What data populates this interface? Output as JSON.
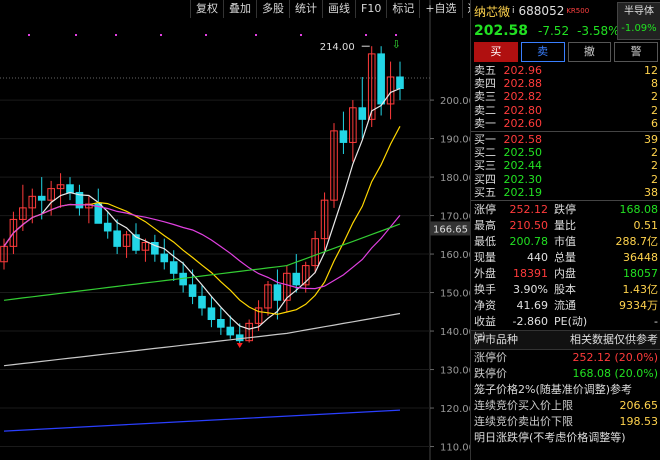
{
  "toolbar": [
    "复权",
    "叠加",
    "多股",
    "统计",
    "画线",
    "F10",
    "标记",
    "+自选",
    "返回"
  ],
  "chart_data": {
    "type": "candlestick",
    "y_ticks": [
      110,
      120,
      130,
      140,
      150,
      160,
      170,
      180,
      190,
      200
    ],
    "ylim": [
      106.5,
      226
    ],
    "current_price_label": "166.65",
    "high_annotation": "214.00",
    "low_marker_value": 136.9,
    "candles": [
      {
        "o": 158,
        "h": 164,
        "l": 156,
        "c": 162
      },
      {
        "o": 162,
        "h": 171,
        "l": 160,
        "c": 169
      },
      {
        "o": 169,
        "h": 178,
        "l": 166,
        "c": 172
      },
      {
        "o": 172,
        "h": 177,
        "l": 168,
        "c": 175
      },
      {
        "o": 175,
        "h": 180,
        "l": 169,
        "c": 174
      },
      {
        "o": 174,
        "h": 179,
        "l": 170,
        "c": 177
      },
      {
        "o": 177,
        "h": 181,
        "l": 172,
        "c": 178
      },
      {
        "o": 178,
        "h": 180,
        "l": 174,
        "c": 176
      },
      {
        "o": 176,
        "h": 178,
        "l": 170,
        "c": 172
      },
      {
        "o": 172,
        "h": 175,
        "l": 168,
        "c": 173
      },
      {
        "o": 173,
        "h": 177,
        "l": 169,
        "c": 168
      },
      {
        "o": 168,
        "h": 171,
        "l": 164,
        "c": 166
      },
      {
        "o": 166,
        "h": 169,
        "l": 160,
        "c": 162
      },
      {
        "o": 162,
        "h": 166,
        "l": 159,
        "c": 165
      },
      {
        "o": 165,
        "h": 168,
        "l": 160,
        "c": 161
      },
      {
        "o": 161,
        "h": 164,
        "l": 158,
        "c": 163
      },
      {
        "o": 163,
        "h": 165,
        "l": 158,
        "c": 160
      },
      {
        "o": 160,
        "h": 164,
        "l": 156,
        "c": 158
      },
      {
        "o": 158,
        "h": 161,
        "l": 153,
        "c": 155
      },
      {
        "o": 155,
        "h": 158,
        "l": 150,
        "c": 152
      },
      {
        "o": 152,
        "h": 156,
        "l": 147,
        "c": 149
      },
      {
        "o": 149,
        "h": 152,
        "l": 144,
        "c": 146
      },
      {
        "o": 146,
        "h": 149,
        "l": 141,
        "c": 143
      },
      {
        "o": 143,
        "h": 146,
        "l": 139,
        "c": 141
      },
      {
        "o": 141,
        "h": 144,
        "l": 138,
        "c": 139
      },
      {
        "o": 139,
        "h": 142,
        "l": 136.9,
        "c": 137.5
      },
      {
        "o": 137.5,
        "h": 143,
        "l": 137,
        "c": 142
      },
      {
        "o": 142,
        "h": 148,
        "l": 140,
        "c": 146
      },
      {
        "o": 146,
        "h": 153,
        "l": 144,
        "c": 152
      },
      {
        "o": 152,
        "h": 156,
        "l": 143,
        "c": 148
      },
      {
        "o": 148,
        "h": 157,
        "l": 145,
        "c": 155
      },
      {
        "o": 155,
        "h": 160,
        "l": 150,
        "c": 152
      },
      {
        "o": 152,
        "h": 158,
        "l": 150,
        "c": 157
      },
      {
        "o": 157,
        "h": 166,
        "l": 155,
        "c": 164
      },
      {
        "o": 164,
        "h": 176,
        "l": 161,
        "c": 174
      },
      {
        "o": 174,
        "h": 194,
        "l": 172,
        "c": 192
      },
      {
        "o": 192,
        "h": 197,
        "l": 186,
        "c": 189
      },
      {
        "o": 189,
        "h": 200,
        "l": 184,
        "c": 198
      },
      {
        "o": 198,
        "h": 206,
        "l": 190,
        "c": 195
      },
      {
        "o": 195,
        "h": 214,
        "l": 193,
        "c": 212
      },
      {
        "o": 212,
        "h": 214,
        "l": 196,
        "c": 199
      },
      {
        "o": 199,
        "h": 210,
        "l": 195,
        "c": 206
      },
      {
        "o": 206,
        "h": 210,
        "l": 200,
        "c": 203
      }
    ]
  },
  "panel": {
    "name": "纳芯微",
    "name_suffix": "i",
    "code": "688052",
    "tag": "KR500",
    "sector": "半导体",
    "sector_change": "-1.09%",
    "price": "202.58",
    "change": "-7.52",
    "change_pct": "-3.58%",
    "buttons": [
      "买",
      "卖",
      "撤",
      "警"
    ],
    "asks": [
      {
        "label": "卖五",
        "price": "202.96",
        "vol": "12"
      },
      {
        "label": "卖四",
        "price": "202.88",
        "vol": "8"
      },
      {
        "label": "卖三",
        "price": "202.82",
        "vol": "2"
      },
      {
        "label": "卖二",
        "price": "202.80",
        "vol": "2"
      },
      {
        "label": "卖一",
        "price": "202.60",
        "vol": "6"
      }
    ],
    "bids": [
      {
        "label": "买一",
        "price": "202.58",
        "vol": "39"
      },
      {
        "label": "买二",
        "price": "202.50",
        "vol": "2"
      },
      {
        "label": "买三",
        "price": "202.44",
        "vol": "2"
      },
      {
        "label": "买四",
        "price": "202.30",
        "vol": "2"
      },
      {
        "label": "买五",
        "price": "202.19",
        "vol": "38"
      }
    ],
    "stats": [
      {
        "k1": "涨停",
        "v1": "252.12",
        "c1": "red",
        "k2": "跌停",
        "v2": "168.08",
        "c2": "green"
      },
      {
        "k1": "最高",
        "v1": "210.50",
        "c1": "red",
        "k2": "量比",
        "v2": "0.51",
        "c2": "yellow"
      },
      {
        "k1": "最低",
        "v1": "200.78",
        "c1": "green",
        "k2": "市值",
        "v2": "288.7亿",
        "c2": "yellow"
      },
      {
        "k1": "现量",
        "v1": "440",
        "c1": "white",
        "k2": "总量",
        "v2": "36448",
        "c2": "yellow"
      },
      {
        "k1": "外盘",
        "v1": "18391",
        "c1": "red",
        "k2": "内盘",
        "v2": "18057",
        "c2": "green"
      },
      {
        "k1": "换手",
        "v1": "3.90%",
        "c1": "white",
        "k2": "股本",
        "v2": "1.43亿",
        "c2": "yellow"
      },
      {
        "k1": "净资",
        "v1": "41.69",
        "c1": "white",
        "k2": "流通",
        "v2": "9334万",
        "c2": "yellow"
      },
      {
        "k1": "收益㈢",
        "v1": "-2.860",
        "c1": "white",
        "k2": "PE(动)",
        "v2": "-",
        "c2": "white"
      }
    ],
    "section_left": "沪市品种",
    "section_right": "相关数据仅供参考",
    "limit_up_label": "涨停价",
    "limit_up_value": "252.12 (20.0%)",
    "limit_down_label": "跌停价",
    "limit_down_value": "168.08 (20.0%)",
    "cage_note": "笼子价格2%(随基准价调整)参考",
    "buy_upper_label": "连续竞价买入价上限",
    "buy_upper_value": "206.65",
    "sell_lower_label": "连续竞价卖出价下限",
    "sell_lower_value": "198.53",
    "bottom_note": "明日涨跌停(不考虑价格调整等)"
  },
  "colors": {
    "up": "#ff3b3b",
    "down": "#22d6e6",
    "ma5": "#e8e8e8",
    "ma10": "#ffd700",
    "ma20": "#e040e0",
    "ma60": "#33cc33",
    "ma120": "#c8c8c8",
    "ma250": "#2a3fff"
  }
}
